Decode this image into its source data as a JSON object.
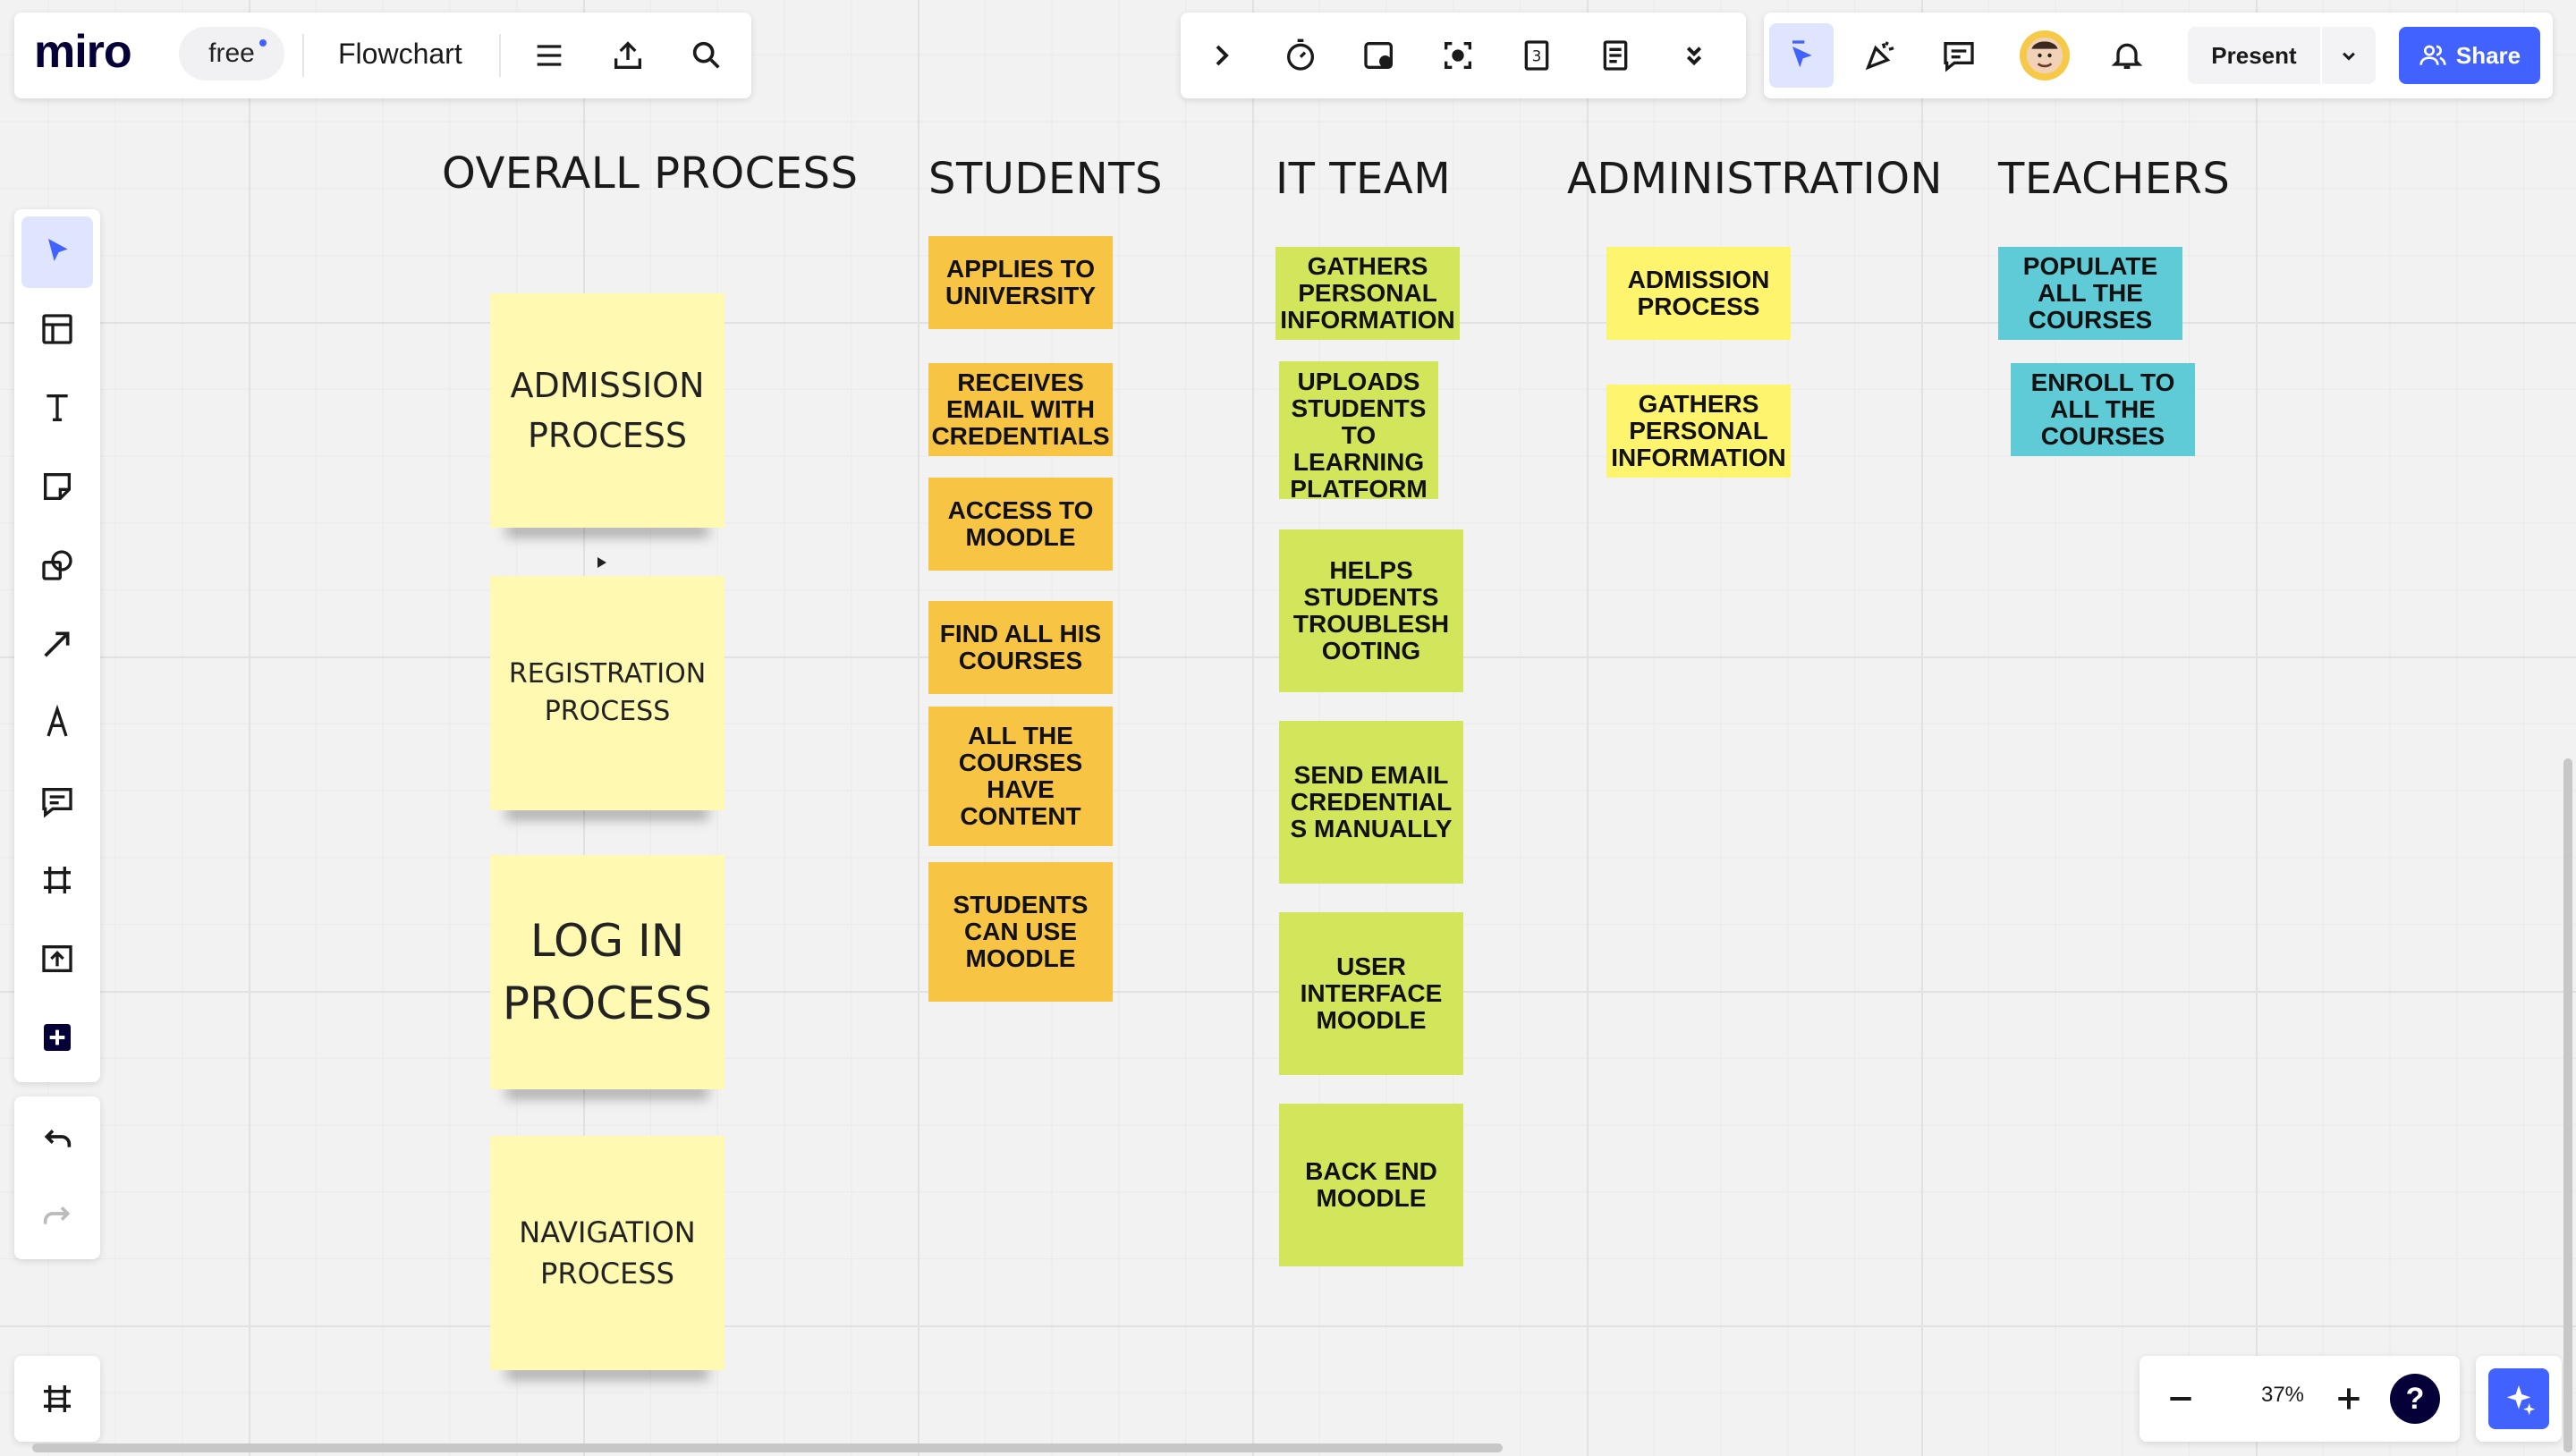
{
  "app": {
    "logo": "miro",
    "plan_badge": "free",
    "board_title": "Flowchart"
  },
  "toolbar_right": {
    "present_label": "Present",
    "share_label": "Share"
  },
  "zoom": {
    "level": "37%"
  },
  "help": {
    "label": "?"
  },
  "columns": {
    "overall": "OVERALL PROCESS",
    "students": "STUDENTS",
    "it_team": "IT TEAM",
    "administration": "ADMINISTRATION",
    "teachers": "TEACHERS"
  },
  "overall_notes": [
    "ADMISSION PROCESS",
    "REGISTRATION PROCESS",
    "LOG IN PROCESS",
    "NAVIGATION PROCESS"
  ],
  "student_notes": [
    "APPLIES TO UNIVERSITY",
    "RECEIVES EMAIL WITH CREDENTIALS",
    "ACCESS TO MOODLE",
    "FIND ALL HIS COURSES",
    "ALL THE COURSES HAVE CONTENT",
    "STUDENTS CAN USE MOODLE"
  ],
  "it_notes": [
    "GATHERS PERSONAL INFORMATION",
    "UPLOADS STUDENTS TO Learning Platform System",
    "HELPS STUDENTS TROUBLESH OOTING",
    "SEND EMAIL CREDENTIAL S MANUALLY",
    "USER INTERFACE MOODLE",
    "BACK END MOODLE"
  ],
  "admin_notes": [
    "ADMISSION PROCESS",
    "GATHERS PERSONAL INFORMATION"
  ],
  "teacher_notes": [
    "POPULATE ALL THE COURSES",
    "ENROLL TO ALL THE COURSES"
  ],
  "colors": {
    "accent": "#4262ff",
    "student_note": "#f8c443",
    "it_note": "#d3e55a",
    "admin_note": "#fff46d",
    "teacher_note": "#5fcbd6",
    "overall_note": "#fff9b1"
  }
}
